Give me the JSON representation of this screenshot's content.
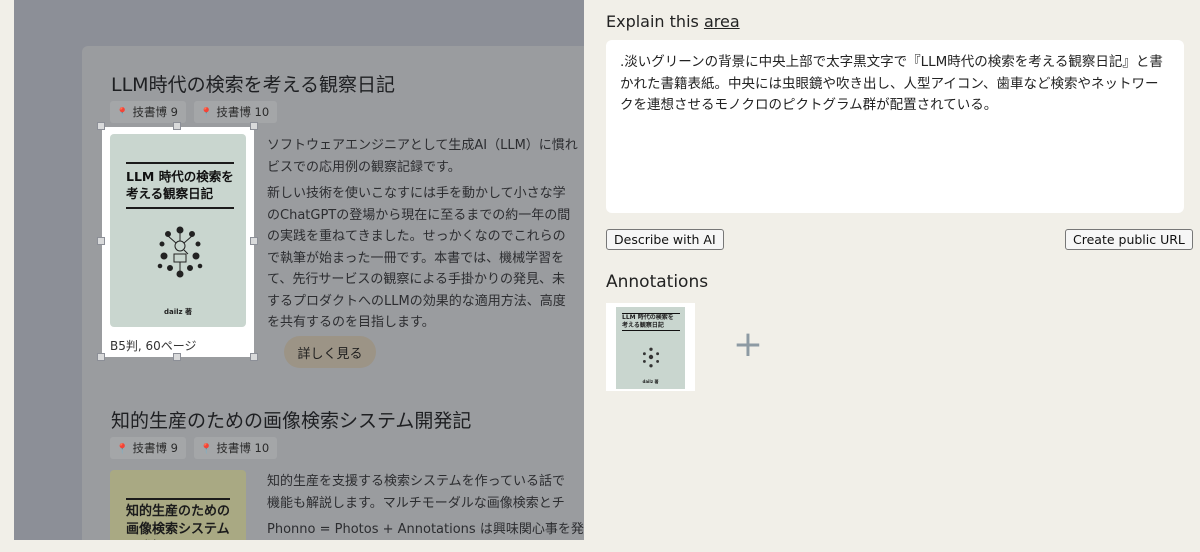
{
  "left": {
    "partial_top_text": "",
    "book1": {
      "title": "LLM時代の検索を考える観察日記",
      "tags": [
        "技書博 9",
        "技書博 10"
      ],
      "cover_title": "LLM 時代の検索を\n考える観察日記",
      "cover_author": "dailz 著",
      "size": "B5判, 60ページ",
      "desc_lines": [
        "ソフトウェアエンジニアとして生成AI（LLM）に慣れ",
        "ビスでの応用例の観察記録です。",
        "新しい技術を使いこなすには手を動かして小さな学",
        "のChatGPTの登場から現在に至るまでの約一年の間",
        "の実践を重ねてきました。せっかくなのでこれらの",
        "で執筆が始まった一冊です。本書では、機械学習を",
        "て、先行サービスの観察による手掛かりの発見、未",
        "するプロダクトへのLLMの効果的な適用方法、高度",
        "を共有するのを目指します。"
      ],
      "more_button": "詳しく見る"
    },
    "book2": {
      "title": "知的生産のための画像検索システム開発記",
      "tags": [
        "技書博 9",
        "技書博 10"
      ],
      "cover_title": "知的生産のための\n画像検索システム\n開発記",
      "desc_lines": [
        "知的生産を支援する検索システムを作っている話で",
        "機能も解説します。マルチモーダルな画像検索とチ",
        "Phonno = Photos + Annotations は興味関心事を発見"
      ]
    }
  },
  "right": {
    "explain_prefix": "Explain this ",
    "explain_link": "area",
    "description": ".淡いグリーンの背景に中央上部で太字黒文字で『LLM時代の検索を考える観察日記』と書かれた書籍表紙。中央には虫眼鏡や吹き出し、人型アイコン、歯車など検索やネットワークを連想させるモノクロのピクトグラム群が配置されている。",
    "describe_button": "Describe with AI",
    "public_url_button": "Create public URL",
    "annotations_label": "Annotations",
    "thumb_title": "LLM 時代の検索を\n考える観察日記",
    "thumb_author": "dailz 著",
    "add_icon": "+"
  },
  "colors": {
    "overlay": "#8c8f97",
    "panel_bg": "#f1efe8",
    "cover_green": "#c9d6cf",
    "more_button_bg": "#9c9486",
    "add_icon": "#8d9aa3"
  }
}
